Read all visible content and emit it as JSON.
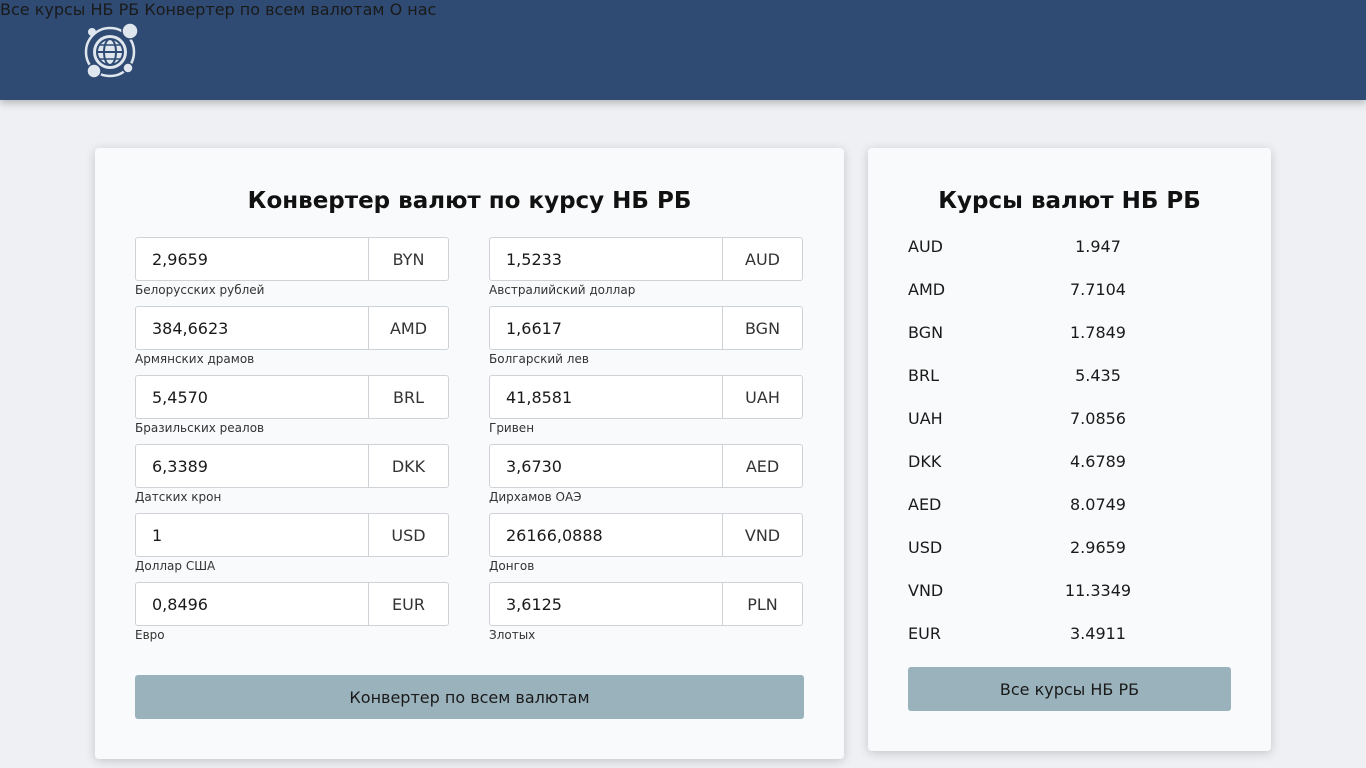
{
  "nav": {
    "items": [
      {
        "label": "Все курсы НБ РБ"
      },
      {
        "label": "Конвертер по всем валютам"
      },
      {
        "label": "О нас"
      }
    ]
  },
  "converter": {
    "title": "Конвертер валют по курсу НБ РБ",
    "fields": [
      {
        "value": "2,9659",
        "code": "BYN",
        "label": "Белорусских рублей"
      },
      {
        "value": "1,5233",
        "code": "AUD",
        "label": "Австралийский доллар"
      },
      {
        "value": "384,6623",
        "code": "AMD",
        "label": "Армянских драмов"
      },
      {
        "value": "1,6617",
        "code": "BGN",
        "label": "Болгарский лев"
      },
      {
        "value": "5,4570",
        "code": "BRL",
        "label": "Бразильских реалов"
      },
      {
        "value": "41,8581",
        "code": "UAH",
        "label": "Гривен"
      },
      {
        "value": "6,3389",
        "code": "DKK",
        "label": "Датских крон"
      },
      {
        "value": "3,6730",
        "code": "AED",
        "label": "Дирхамов ОАЭ"
      },
      {
        "value": "1",
        "code": "USD",
        "label": "Доллар США"
      },
      {
        "value": "26166,0888",
        "code": "VND",
        "label": "Донгов"
      },
      {
        "value": "0,8496",
        "code": "EUR",
        "label": "Евро"
      },
      {
        "value": "3,6125",
        "code": "PLN",
        "label": "Злотых"
      }
    ],
    "button_label": "Конвертер по всем валютам"
  },
  "rates": {
    "title": "Курсы валют НБ РБ",
    "items": [
      {
        "code": "AUD",
        "value": "1.947"
      },
      {
        "code": "AMD",
        "value": "7.7104"
      },
      {
        "code": "BGN",
        "value": "1.7849"
      },
      {
        "code": "BRL",
        "value": "5.435"
      },
      {
        "code": "UAH",
        "value": "7.0856"
      },
      {
        "code": "DKK",
        "value": "4.6789"
      },
      {
        "code": "AED",
        "value": "8.0749"
      },
      {
        "code": "USD",
        "value": "2.9659"
      },
      {
        "code": "VND",
        "value": "11.3349"
      },
      {
        "code": "EUR",
        "value": "3.4911"
      }
    ],
    "button_label": "Все курсы НБ РБ"
  },
  "colors": {
    "header_bg": "#2f4b73",
    "button_bg": "#9ab2bc",
    "page_bg": "#eef0f4"
  },
  "icons": {
    "logo": "globe-coins-icon"
  }
}
